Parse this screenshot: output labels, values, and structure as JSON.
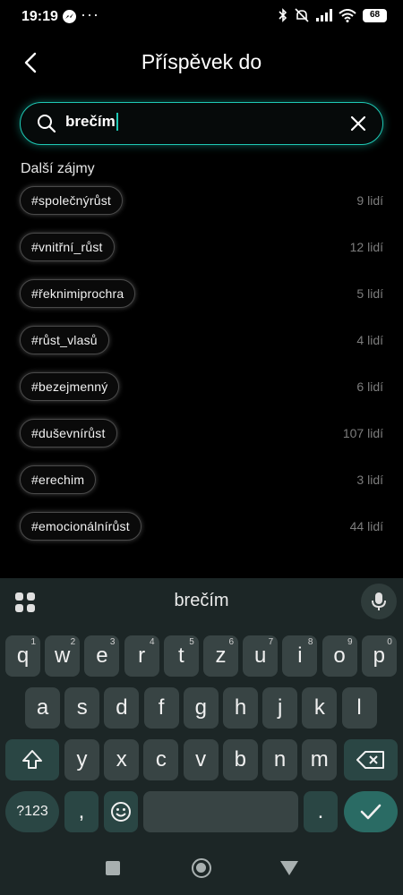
{
  "status_bar": {
    "time": "19:19",
    "dots": "···",
    "battery": "68"
  },
  "header": {
    "title": "Příspěvek do"
  },
  "search": {
    "value": "brečím"
  },
  "section": {
    "label": "Další zájmy"
  },
  "topics": [
    {
      "tag": "#společnýrůst",
      "count": "9 lidí"
    },
    {
      "tag": "#vnitřní_růst",
      "count": "12 lidí"
    },
    {
      "tag": "#řeknimiprochra",
      "count": "5 lidí"
    },
    {
      "tag": "#růst_vlasů",
      "count": "4 lidí"
    },
    {
      "tag": "#bezejmenný",
      "count": "6 lidí"
    },
    {
      "tag": "#duševnírůst",
      "count": "107 lidí"
    },
    {
      "tag": "#erechim",
      "count": "3 lidí"
    },
    {
      "tag": "#emocionálnírůst",
      "count": "44 lidí"
    }
  ],
  "keyboard": {
    "suggestion": "brečím",
    "row1": [
      {
        "key": "q",
        "hint": "1"
      },
      {
        "key": "w",
        "hint": "2"
      },
      {
        "key": "e",
        "hint": "3"
      },
      {
        "key": "r",
        "hint": "4"
      },
      {
        "key": "t",
        "hint": "5"
      },
      {
        "key": "z",
        "hint": "6"
      },
      {
        "key": "u",
        "hint": "7"
      },
      {
        "key": "i",
        "hint": "8"
      },
      {
        "key": "o",
        "hint": "9"
      },
      {
        "key": "p",
        "hint": "0"
      }
    ],
    "row2": [
      "a",
      "s",
      "d",
      "f",
      "g",
      "h",
      "j",
      "k",
      "l"
    ],
    "row3": [
      "y",
      "x",
      "c",
      "v",
      "b",
      "n",
      "m"
    ],
    "symbols_label": "?123",
    "comma": ",",
    "period": "."
  }
}
